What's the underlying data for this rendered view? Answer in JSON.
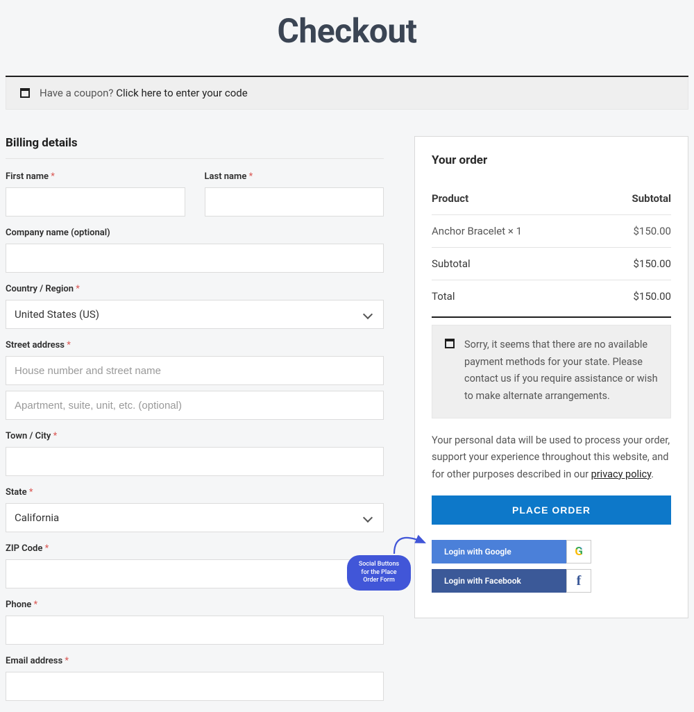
{
  "page_title": "Checkout",
  "coupon": {
    "prompt": "Have a coupon? ",
    "link": "Click here to enter your code"
  },
  "billing": {
    "heading": "Billing details",
    "first_name_label": "First name",
    "last_name_label": "Last name",
    "company_label": "Company name (optional)",
    "country_label": "Country / Region",
    "country_value": "United States (US)",
    "street_label": "Street address",
    "street1_placeholder": "House number and street name",
    "street2_placeholder": "Apartment, suite, unit, etc. (optional)",
    "city_label": "Town / City",
    "state_label": "State",
    "state_value": "California",
    "zip_label": "ZIP Code",
    "phone_label": "Phone",
    "email_label": "Email address"
  },
  "order": {
    "heading": "Your order",
    "product_header": "Product",
    "subtotal_header": "Subtotal",
    "line_item_name": "Anchor Bracelet × 1",
    "line_item_price": "$150.00",
    "subtotal_label": "Subtotal",
    "subtotal_value": "$150.00",
    "total_label": "Total",
    "total_value": "$150.00",
    "no_payment_msg": "Sorry, it seems that there are no available payment methods for your state. Please contact us if you require assistance or wish to make alternate arrangements.",
    "privacy_text": "Your personal data will be used to process your order, support your experience throughout this website, and for other purposes described in our ",
    "privacy_link": "privacy policy",
    "place_order": "PLACE ORDER",
    "login_google": "Login with Google",
    "login_facebook": "Login with Facebook"
  },
  "annotation": "Social Buttons for the Place Order Form",
  "required_mark": "*"
}
